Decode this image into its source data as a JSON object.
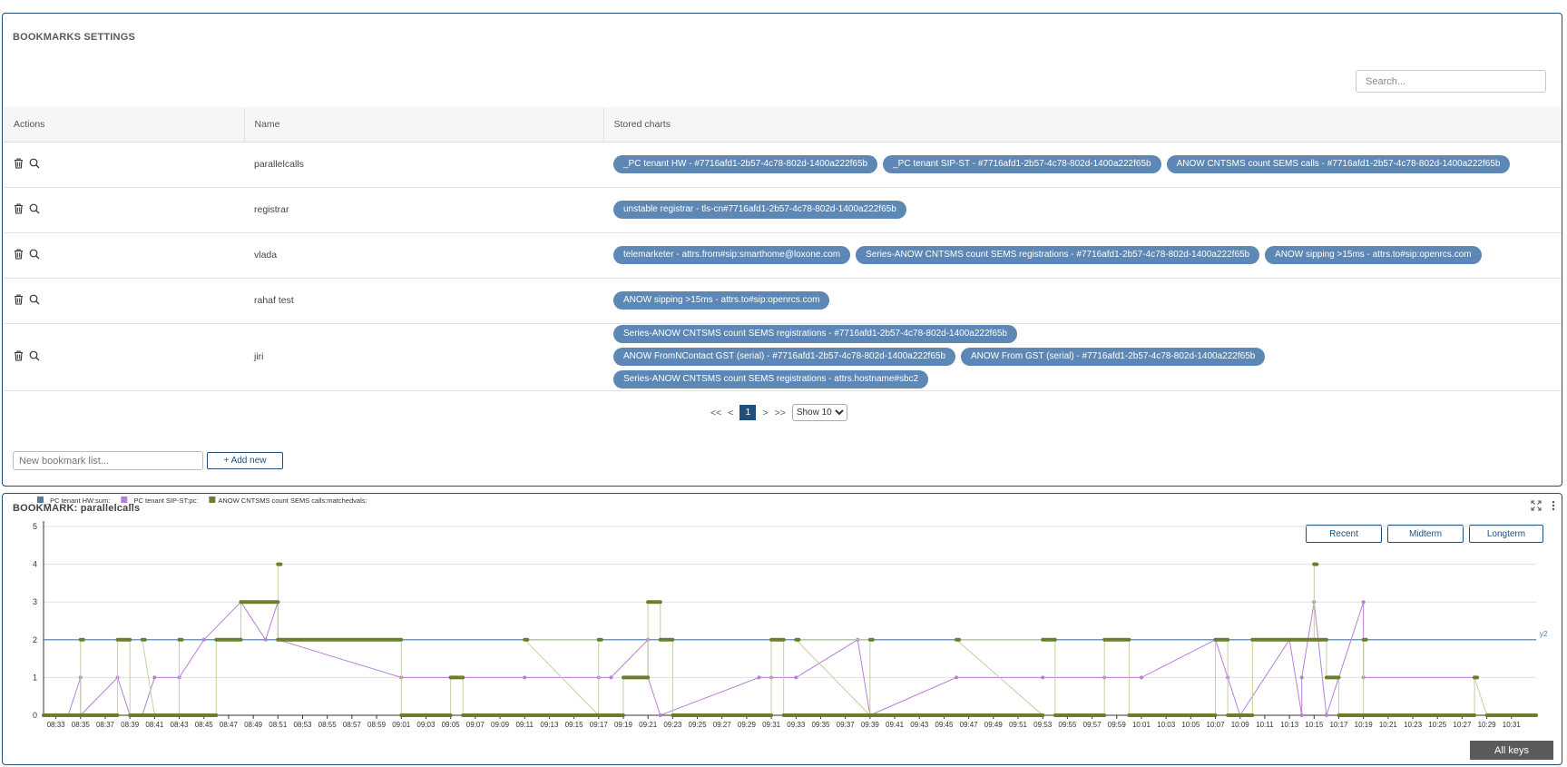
{
  "settings": {
    "title": "BOOKMARKS SETTINGS",
    "search_placeholder": "Search...",
    "columns": [
      "Actions",
      "Name",
      "Stored charts"
    ],
    "rows": [
      {
        "name": "parallelcalls",
        "charts": [
          "_PC tenant HW - #7716afd1-2b57-4c78-802d-1400a222f65b",
          "_PC tenant SIP-ST - #7716afd1-2b57-4c78-802d-1400a222f65b",
          "ANOW CNTSMS count SEMS calls - #7716afd1-2b57-4c78-802d-1400a222f65b"
        ]
      },
      {
        "name": "registrar",
        "charts": [
          "unstable registrar - tls-cn#7716afd1-2b57-4c78-802d-1400a222f65b"
        ]
      },
      {
        "name": "vlada",
        "charts": [
          "telemarketer - attrs.from#sip:smarthome@loxone.com",
          "Series-ANOW CNTSMS count SEMS registrations - #7716afd1-2b57-4c78-802d-1400a222f65b",
          "ANOW sipping >15ms - attrs.to#sip:openrcs.com"
        ]
      },
      {
        "name": "rahaf test",
        "charts": [
          "ANOW sipping >15ms - attrs.to#sip:openrcs.com"
        ]
      },
      {
        "name": "jiri",
        "charts": [
          "Series-ANOW CNTSMS count SEMS registrations - #7716afd1-2b57-4c78-802d-1400a222f65b",
          "ANOW FromNContact GST (serial) - #7716afd1-2b57-4c78-802d-1400a222f65b",
          "ANOW From GST (serial) - #7716afd1-2b57-4c78-802d-1400a222f65b",
          "Series-ANOW CNTSMS count SEMS registrations - attrs.hostname#sbc2"
        ]
      }
    ],
    "pagination": {
      "first": "<<",
      "prev": "<",
      "current": "1",
      "next": ">",
      "last": ">>",
      "page_size": "Show 10"
    },
    "new_list_placeholder": "New bookmark list...",
    "add_new_label": "+ Add new"
  },
  "bookmark": {
    "title": "BOOKMARK: parallelcalls",
    "buttons": {
      "recent": "Recent",
      "midterm": "Midterm",
      "longterm": "Longterm"
    },
    "all_keys_label": "All keys",
    "icons": [
      "expand-icon",
      "more-vertical-icon"
    ]
  },
  "chart_data": {
    "type": "line",
    "title": "",
    "xlabel": "",
    "ylabel": "",
    "ylim": [
      0,
      5
    ],
    "yticks": [
      0,
      1,
      2,
      3,
      4,
      5
    ],
    "xticks": [
      "08:33",
      "08:35",
      "08:37",
      "08:39",
      "08:41",
      "08:43",
      "08:45",
      "08:47",
      "08:49",
      "08:51",
      "08:53",
      "08:55",
      "08:57",
      "08:59",
      "09:01",
      "09:03",
      "09:05",
      "09:07",
      "09:09",
      "09:11",
      "09:13",
      "09:15",
      "09:17",
      "09:19",
      "09:21",
      "09:23",
      "09:25",
      "09:27",
      "09:29",
      "09:31",
      "09:33",
      "09:35",
      "09:37",
      "09:39",
      "09:41",
      "09:43",
      "09:45",
      "09:47",
      "09:49",
      "09:51",
      "09:53",
      "09:55",
      "09:57",
      "09:59",
      "10:01",
      "10:03",
      "10:05",
      "10:07",
      "10:09",
      "10:11",
      "10:13",
      "10:15",
      "10:17",
      "10:19",
      "10:21",
      "10:23",
      "10:25",
      "10:27",
      "10:29",
      "10:31"
    ],
    "reference_line": {
      "value": 2,
      "label": "y2",
      "color": "#4a7fa8"
    },
    "grid": true,
    "legend_position": "top-left",
    "series": [
      {
        "name": "_PC tenant HW:sum:",
        "color": "#4a7fa8",
        "x": [
          "08:32",
          "10:33"
        ],
        "values": [
          2,
          2
        ]
      },
      {
        "name": "_PC tenant SIP-ST:pc:",
        "color": "#b87fd6",
        "x": [
          "08:34",
          "08:35",
          "08:35",
          "08:38",
          "08:39",
          "08:40",
          "08:41",
          "08:43",
          "08:43",
          "08:45",
          "08:48",
          "08:50",
          "08:51",
          "08:51",
          "09:01",
          "09:05",
          "09:11",
          "09:17",
          "09:18",
          "09:21",
          "09:21",
          "09:22",
          "09:30",
          "09:31",
          "09:33",
          "09:38",
          "09:39",
          "09:46",
          "09:53",
          "09:58",
          "10:01",
          "10:07",
          "10:08",
          "10:09",
          "10:13",
          "10:14",
          "10:14",
          "10:15",
          "10:16",
          "10:19",
          "10:19",
          "10:28"
        ],
        "values": [
          0,
          1,
          0,
          1,
          0,
          0,
          1,
          1,
          1,
          2,
          3,
          2,
          3,
          2,
          1,
          1,
          1,
          1,
          1,
          2,
          1,
          0,
          1,
          1,
          1,
          2,
          0,
          1,
          1,
          1,
          1,
          2,
          1,
          0,
          2,
          0,
          1,
          3,
          0,
          3,
          1,
          1
        ]
      },
      {
        "name": "ANOW CNTSMS count SEMS calls:matchedvals:",
        "color": "#6b7f2a",
        "segments": [
          {
            "x0": "08:32",
            "x1": "08:35",
            "y": 0
          },
          {
            "x0": "08:35",
            "x1": "08:35",
            "y": 2
          },
          {
            "x0": "08:35",
            "x1": "08:38",
            "y": 0
          },
          {
            "x0": "08:38",
            "x1": "08:39",
            "y": 2
          },
          {
            "x0": "08:39",
            "x1": "08:41",
            "y": 0
          },
          {
            "x0": "08:40",
            "x1": "08:40",
            "y": 2
          },
          {
            "x0": "08:41",
            "x1": "08:43",
            "y": 0
          },
          {
            "x0": "08:43",
            "x1": "08:43",
            "y": 2
          },
          {
            "x0": "08:43",
            "x1": "08:46",
            "y": 0
          },
          {
            "x0": "08:46",
            "x1": "08:48",
            "y": 2
          },
          {
            "x0": "08:48",
            "x1": "08:51",
            "y": 3
          },
          {
            "x0": "08:51",
            "x1": "08:51",
            "y": 4
          },
          {
            "x0": "08:51",
            "x1": "09:01",
            "y": 2
          },
          {
            "x0": "09:01",
            "x1": "09:05",
            "y": 0
          },
          {
            "x0": "09:05",
            "x1": "09:06",
            "y": 1
          },
          {
            "x0": "09:06",
            "x1": "09:17",
            "y": 0
          },
          {
            "x0": "09:11",
            "x1": "09:11",
            "y": 2
          },
          {
            "x0": "09:17",
            "x1": "09:17",
            "y": 2
          },
          {
            "x0": "09:17",
            "x1": "09:19",
            "y": 0
          },
          {
            "x0": "09:19",
            "x1": "09:21",
            "y": 1
          },
          {
            "x0": "09:21",
            "x1": "09:22",
            "y": 3
          },
          {
            "x0": "09:22",
            "x1": "09:23",
            "y": 2
          },
          {
            "x0": "09:23",
            "x1": "09:31",
            "y": 0
          },
          {
            "x0": "09:31",
            "x1": "09:32",
            "y": 2
          },
          {
            "x0": "09:32",
            "x1": "09:39",
            "y": 0
          },
          {
            "x0": "09:33",
            "x1": "09:33",
            "y": 2
          },
          {
            "x0": "09:39",
            "x1": "09:39",
            "y": 2
          },
          {
            "x0": "09:39",
            "x1": "09:53",
            "y": 0
          },
          {
            "x0": "09:46",
            "x1": "09:46",
            "y": 2
          },
          {
            "x0": "09:53",
            "x1": "09:54",
            "y": 2
          },
          {
            "x0": "09:54",
            "x1": "09:58",
            "y": 0
          },
          {
            "x0": "09:58",
            "x1": "10:00",
            "y": 2
          },
          {
            "x0": "10:00",
            "x1": "10:07",
            "y": 0
          },
          {
            "x0": "10:07",
            "x1": "10:08",
            "y": 2
          },
          {
            "x0": "10:08",
            "x1": "10:10",
            "y": 0
          },
          {
            "x0": "10:10",
            "x1": "10:15",
            "y": 2
          },
          {
            "x0": "10:15",
            "x1": "10:15",
            "y": 4
          },
          {
            "x0": "10:15",
            "x1": "10:16",
            "y": 2
          },
          {
            "x0": "10:16",
            "x1": "10:17",
            "y": 1
          },
          {
            "x0": "10:17",
            "x1": "10:19",
            "y": 0
          },
          {
            "x0": "10:19",
            "x1": "10:19",
            "y": 2
          },
          {
            "x0": "10:19",
            "x1": "10:28",
            "y": 0
          },
          {
            "x0": "10:28",
            "x1": "10:28",
            "y": 1
          },
          {
            "x0": "10:29",
            "x1": "10:33",
            "y": 0
          }
        ]
      }
    ]
  }
}
